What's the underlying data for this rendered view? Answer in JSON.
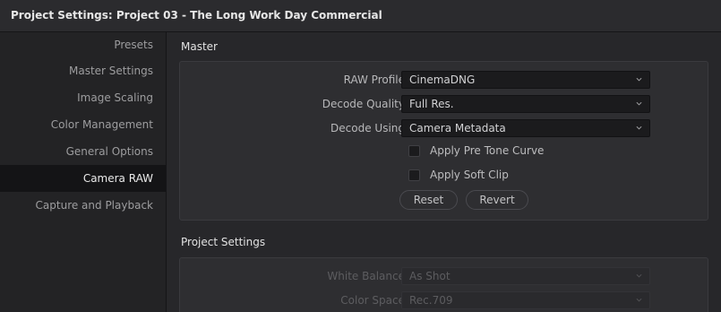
{
  "window": {
    "title": "Project Settings:  Project 03 - The Long Work Day Commercial"
  },
  "sidebar": {
    "items": [
      {
        "label": "Presets"
      },
      {
        "label": "Master Settings"
      },
      {
        "label": "Image Scaling"
      },
      {
        "label": "Color Management"
      },
      {
        "label": "General Options"
      },
      {
        "label": "Camera RAW",
        "active": true
      },
      {
        "label": "Capture and Playback"
      }
    ]
  },
  "master": {
    "title": "Master",
    "raw_profile": {
      "label": "RAW Profile",
      "value": "CinemaDNG"
    },
    "decode_quality": {
      "label": "Decode Quality",
      "value": "Full Res."
    },
    "decode_using": {
      "label": "Decode Using",
      "value": "Camera Metadata"
    },
    "apply_pre_tone_curve": {
      "label": "Apply Pre Tone Curve",
      "checked": false
    },
    "apply_soft_clip": {
      "label": "Apply Soft Clip",
      "checked": false
    },
    "reset_label": "Reset",
    "revert_label": "Revert"
  },
  "project_settings": {
    "title": "Project Settings",
    "white_balance": {
      "label": "White Balance",
      "value": "As Shot"
    },
    "color_space": {
      "label": "Color Space",
      "value": "Rec.709"
    }
  },
  "icons": {
    "dropdown": "chevron-down-icon"
  },
  "colors": {
    "active_item_bg": "#141416",
    "panel_bg": "#2e2e31",
    "window_bg": "#27272a"
  }
}
